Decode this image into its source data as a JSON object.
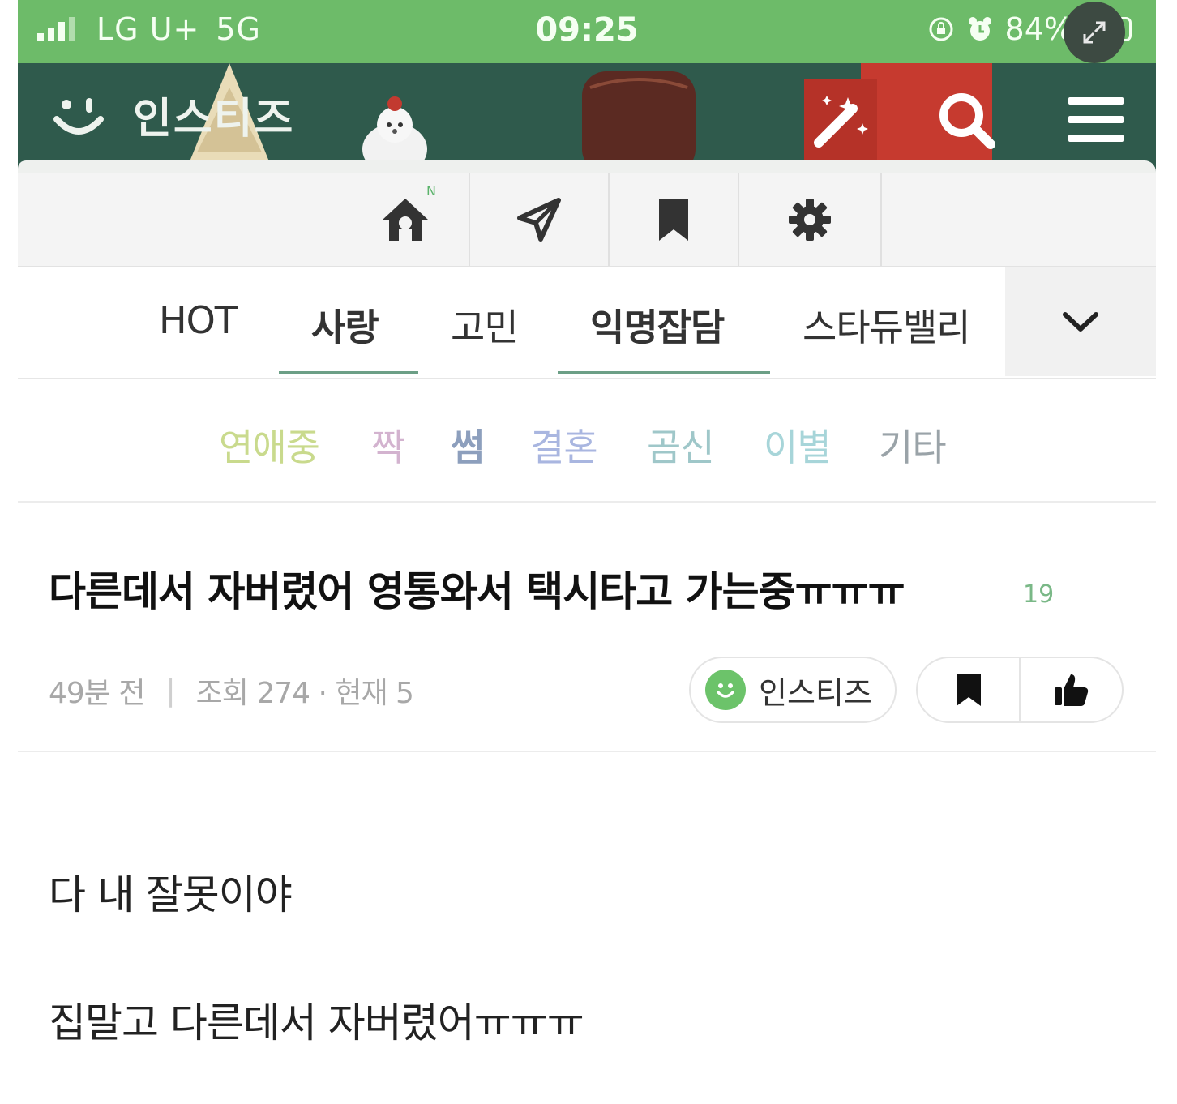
{
  "status_bar": {
    "carrier": "LG U+",
    "network": "5G",
    "time": "09:25",
    "battery": "84%",
    "battery_level": 0.84
  },
  "app": {
    "name": "인스티즈",
    "header_icons": [
      "magic-wand-icon",
      "search-icon",
      "menu-icon"
    ]
  },
  "toolbar": {
    "items": [
      "home-icon",
      "send-icon",
      "bookmark-icon",
      "settings-icon"
    ],
    "home_badge": "N"
  },
  "category_tabs": {
    "items": [
      "HOT",
      "사랑",
      "고민",
      "익명잡담",
      "스타듀밸리"
    ],
    "active": [
      "사랑",
      "익명잡담"
    ]
  },
  "sub_tabs": {
    "items": [
      {
        "label": "연애중",
        "color": "#c9da8d"
      },
      {
        "label": "짝",
        "color": "#d3b3cf"
      },
      {
        "label": "썸",
        "color": "#8d9fbd"
      },
      {
        "label": "결혼",
        "color": "#a9b6e0"
      },
      {
        "label": "곰신",
        "color": "#9fc7c9"
      },
      {
        "label": "이별",
        "color": "#a7d5d9"
      },
      {
        "label": "기타",
        "color": "#9aa3a8"
      }
    ]
  },
  "post": {
    "title": "다른데서 자버렸어 영통와서 택시타고 가는중ㅠㅠㅠ",
    "comment_count": "19",
    "time_ago": "49분 전",
    "views": "조회 274 · 현재 5",
    "author": "인스티즈",
    "body": [
      "다 내 잘못이야",
      "집말고 다른데서 자버렸어ㅠㅠㅠ"
    ]
  },
  "colors": {
    "status_green": "#6dbb69",
    "header_green": "#2f5a4c",
    "accent": "#6c9f86"
  }
}
